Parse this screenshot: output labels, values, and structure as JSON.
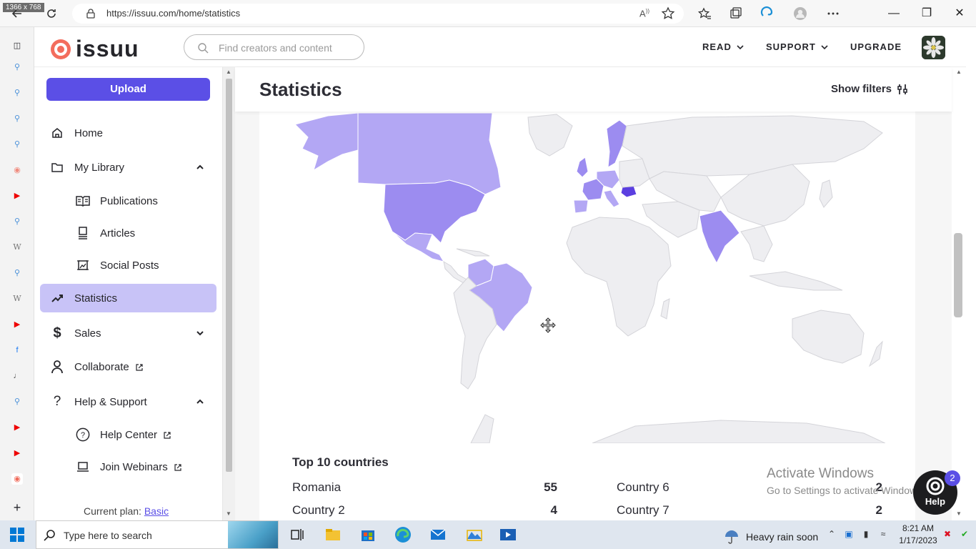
{
  "screen_badge": "1366 x 768",
  "browser": {
    "url": "https://issuu.com/home/statistics"
  },
  "header": {
    "logo_text": "issuu",
    "search_placeholder": "Find creators and content",
    "nav": [
      {
        "label": "READ"
      },
      {
        "label": "SUPPORT"
      },
      {
        "label": "UPGRADE"
      }
    ]
  },
  "sidebar": {
    "upload_label": "Upload",
    "items": [
      {
        "label": "Home",
        "icon": "home-icon"
      },
      {
        "label": "My Library",
        "icon": "folder-icon"
      },
      {
        "label": "Publications",
        "icon": "book-open-icon"
      },
      {
        "label": "Articles",
        "icon": "article-icon"
      },
      {
        "label": "Social Posts",
        "icon": "social-post-icon"
      },
      {
        "label": "Statistics",
        "icon": "trend-icon"
      },
      {
        "label": "Sales",
        "icon": "dollar-icon"
      },
      {
        "label": "Collaborate",
        "icon": "person-icon"
      },
      {
        "label": "Help & Support",
        "icon": "question-icon"
      },
      {
        "label": "Help Center",
        "icon": "help-circle-icon"
      },
      {
        "label": "Join Webinars",
        "icon": "laptop-icon"
      }
    ],
    "plan_label": "Current plan:",
    "plan_value": "Basic"
  },
  "main": {
    "title": "Statistics",
    "show_filters": "Show filters",
    "top10_title": "Top 10 countries",
    "countries": [
      {
        "name": "Romania",
        "value": "55"
      },
      {
        "name": "Country 2",
        "value": "4"
      },
      {
        "name": "Country 6",
        "value": "2"
      },
      {
        "name": "Country 7",
        "value": "2"
      }
    ]
  },
  "colors": {
    "accent": "#5b4fe6",
    "map_highlight_strong": "#5b3fe0",
    "map_highlight_medium": "#9c8cf0",
    "map_highlight_light": "#b3a7f4",
    "map_base": "#eeeef1"
  },
  "watermark": {
    "line1": "Activate Windows",
    "line2": "Go to Settings to activate Windows."
  },
  "help": {
    "label": "Help",
    "badge": "2"
  },
  "taskbar": {
    "search_placeholder": "Type here to search",
    "weather": "Heavy rain soon",
    "time": "8:21 AM",
    "date": "1/17/2023"
  }
}
